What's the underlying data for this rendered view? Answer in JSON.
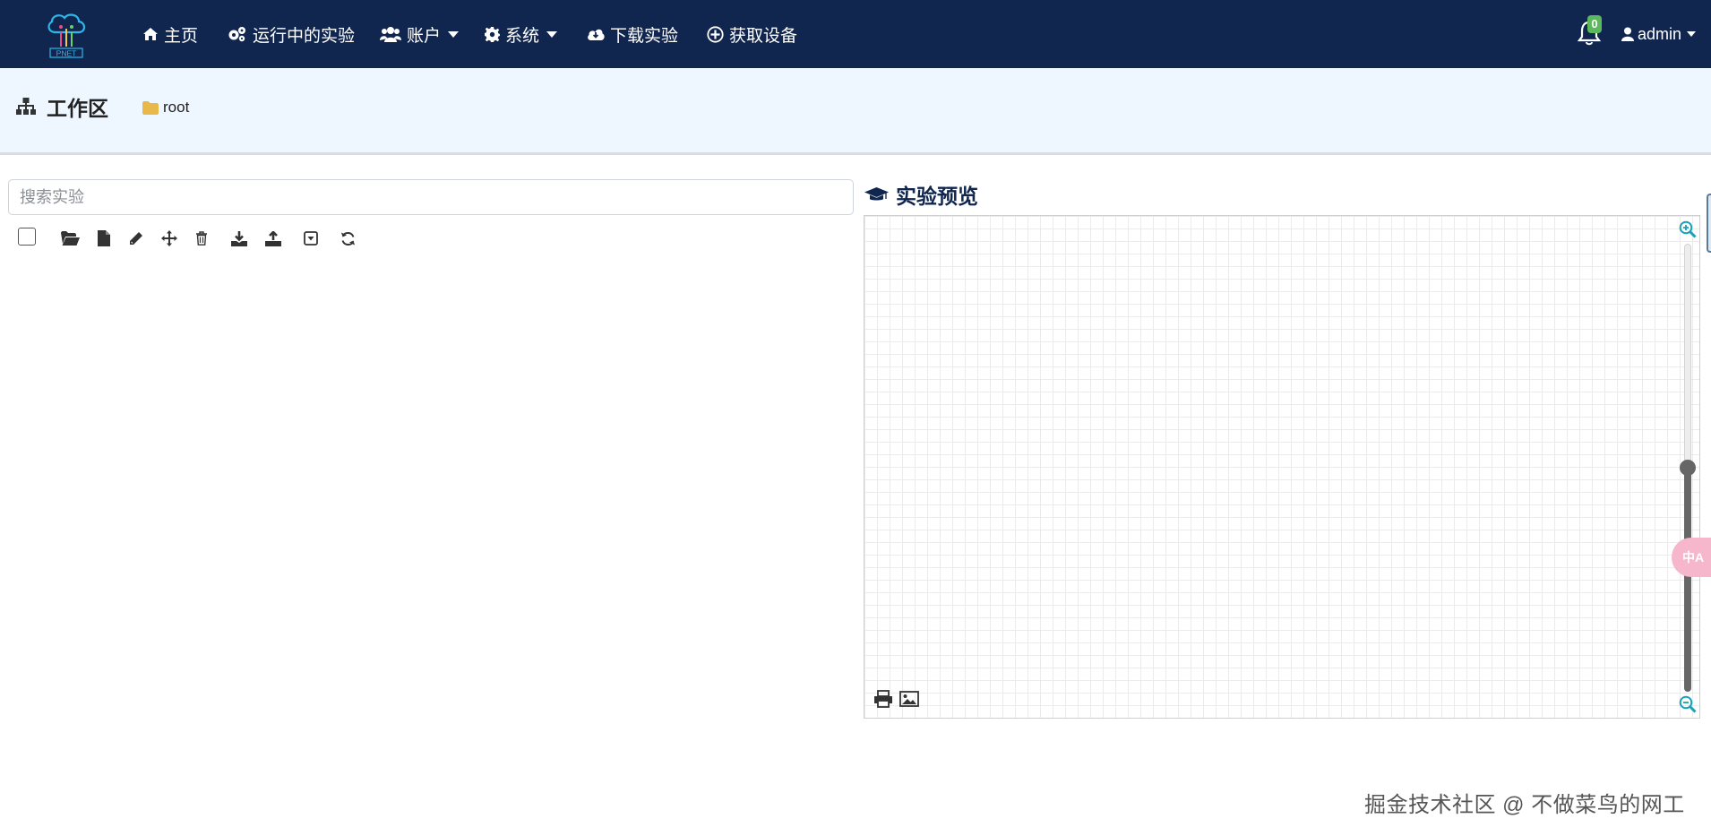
{
  "app": {
    "logo_text": "PNET"
  },
  "nav": {
    "home": "主页",
    "running_labs": "运行中的实验",
    "accounts": "账户",
    "system": "系统",
    "download_labs": "下载实验",
    "get_devices": "获取设备",
    "notification_count": "0",
    "user": "admin"
  },
  "workspace": {
    "title": "工作区",
    "breadcrumb": "root"
  },
  "search": {
    "placeholder": "搜索实验",
    "value": ""
  },
  "preview": {
    "title": "实验预览",
    "zoom_level": 0.5
  },
  "translate_widget": {
    "label": "中A"
  },
  "watermark": "掘金技术社区 @ 不做菜鸟的网工",
  "colors": {
    "navbar": "#10264f",
    "header_bg": "#eef7ff",
    "accent": "#17a2b8",
    "folder": "#e8b84a",
    "badge": "#5cb85c"
  }
}
